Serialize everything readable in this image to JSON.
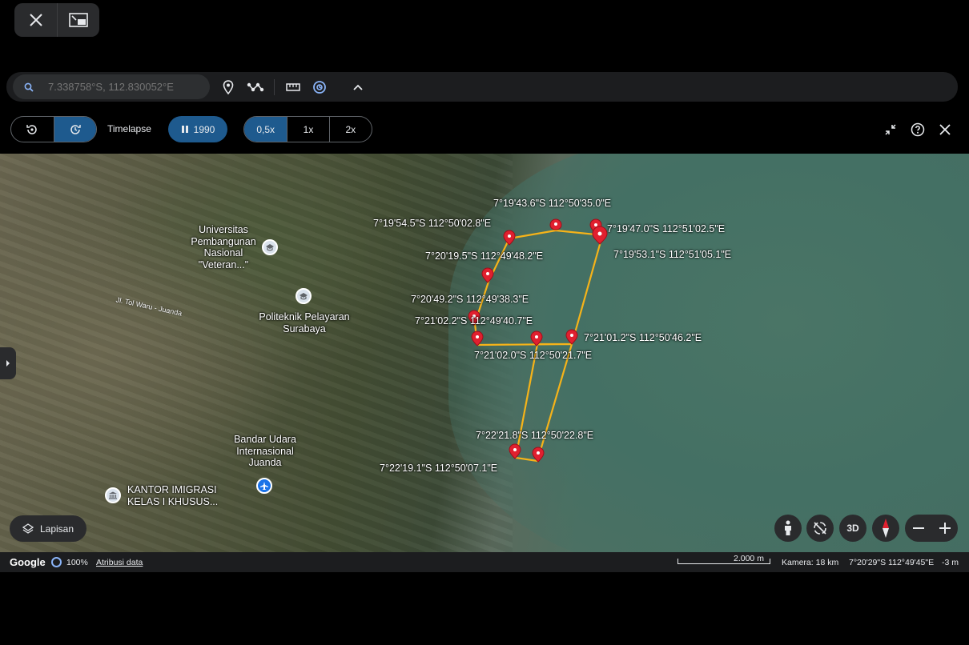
{
  "search": {
    "placeholder": "7.338758°S, 112.830052°E"
  },
  "timelapse": {
    "label": "Timelapse",
    "year": "1990",
    "speeds": [
      "0,5x",
      "1x",
      "2x"
    ],
    "active_speed": "0,5x"
  },
  "map": {
    "markers": [
      {
        "label": "7°19'43.6\"S 112°50'35.0\"E"
      },
      {
        "label": "7°19'54.5\"S 112°50'02.8\"E"
      },
      {
        "label": "7°19'47.0\"S 112°51'02.5\"E"
      },
      {
        "label": "7°19'53.1\"S 112°51'05.1\"E"
      },
      {
        "label": "7°20'19.5\"S 112°49'48.2\"E"
      },
      {
        "label": "7°20'49.2\"S 112°49'38.3\"E"
      },
      {
        "label": "7°21'02.2\"S 112°49'40.7\"E"
      },
      {
        "label": "7°21'01.2\"S 112°50'46.2\"E"
      },
      {
        "label": "7°21'02.0\"S 112°50'21.7\"E"
      },
      {
        "label": "7°22'21.8\"S 112°50'22.8\"E"
      },
      {
        "label": "7°22'19.1\"S 112°50'07.1\"E"
      }
    ],
    "places": {
      "upn": "Universitas Pembangunan Nasional \"Veteran...\"",
      "politeknik": "Politeknik Pelayaran Surabaya",
      "airport": "Bandar Udara Internasional Juanda",
      "imigrasi": "KANTOR IMIGRASI KELAS I KHUSUS...",
      "road": "Jl. Tol Waru - Juanda"
    },
    "path_color": "#f6b319",
    "marker_color": "#e0202f"
  },
  "controls": {
    "layers_label": "Lapisan",
    "three_d_label": "3D"
  },
  "status": {
    "brand": "Google",
    "percent": "100%",
    "attribution": "Atribusi data",
    "scale": "2.000 m",
    "camera": "Kamera: 18 km",
    "position": "7°20'29\"S 112°49'45\"E",
    "elevation": "-3 m"
  }
}
